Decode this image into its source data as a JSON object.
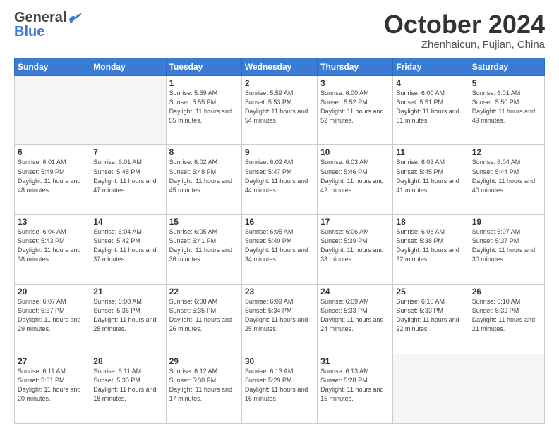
{
  "header": {
    "logo_general": "General",
    "logo_blue": "Blue",
    "title": "October 2024",
    "location": "Zhenhaicun, Fujian, China"
  },
  "weekdays": [
    "Sunday",
    "Monday",
    "Tuesday",
    "Wednesday",
    "Thursday",
    "Friday",
    "Saturday"
  ],
  "weeks": [
    [
      {
        "day": "",
        "empty": true
      },
      {
        "day": "",
        "empty": true
      },
      {
        "day": "1",
        "sunrise": "Sunrise: 5:59 AM",
        "sunset": "Sunset: 5:55 PM",
        "daylight": "Daylight: 11 hours and 55 minutes."
      },
      {
        "day": "2",
        "sunrise": "Sunrise: 5:59 AM",
        "sunset": "Sunset: 5:53 PM",
        "daylight": "Daylight: 11 hours and 54 minutes."
      },
      {
        "day": "3",
        "sunrise": "Sunrise: 6:00 AM",
        "sunset": "Sunset: 5:52 PM",
        "daylight": "Daylight: 11 hours and 52 minutes."
      },
      {
        "day": "4",
        "sunrise": "Sunrise: 6:00 AM",
        "sunset": "Sunset: 5:51 PM",
        "daylight": "Daylight: 11 hours and 51 minutes."
      },
      {
        "day": "5",
        "sunrise": "Sunrise: 6:01 AM",
        "sunset": "Sunset: 5:50 PM",
        "daylight": "Daylight: 11 hours and 49 minutes."
      }
    ],
    [
      {
        "day": "6",
        "sunrise": "Sunrise: 6:01 AM",
        "sunset": "Sunset: 5:49 PM",
        "daylight": "Daylight: 11 hours and 48 minutes."
      },
      {
        "day": "7",
        "sunrise": "Sunrise: 6:01 AM",
        "sunset": "Sunset: 5:48 PM",
        "daylight": "Daylight: 11 hours and 47 minutes."
      },
      {
        "day": "8",
        "sunrise": "Sunrise: 6:02 AM",
        "sunset": "Sunset: 5:48 PM",
        "daylight": "Daylight: 11 hours and 45 minutes."
      },
      {
        "day": "9",
        "sunrise": "Sunrise: 6:02 AM",
        "sunset": "Sunset: 5:47 PM",
        "daylight": "Daylight: 11 hours and 44 minutes."
      },
      {
        "day": "10",
        "sunrise": "Sunrise: 6:03 AM",
        "sunset": "Sunset: 5:46 PM",
        "daylight": "Daylight: 11 hours and 42 minutes."
      },
      {
        "day": "11",
        "sunrise": "Sunrise: 6:03 AM",
        "sunset": "Sunset: 5:45 PM",
        "daylight": "Daylight: 11 hours and 41 minutes."
      },
      {
        "day": "12",
        "sunrise": "Sunrise: 6:04 AM",
        "sunset": "Sunset: 5:44 PM",
        "daylight": "Daylight: 11 hours and 40 minutes."
      }
    ],
    [
      {
        "day": "13",
        "sunrise": "Sunrise: 6:04 AM",
        "sunset": "Sunset: 5:43 PM",
        "daylight": "Daylight: 11 hours and 38 minutes."
      },
      {
        "day": "14",
        "sunrise": "Sunrise: 6:04 AM",
        "sunset": "Sunset: 5:42 PM",
        "daylight": "Daylight: 11 hours and 37 minutes."
      },
      {
        "day": "15",
        "sunrise": "Sunrise: 6:05 AM",
        "sunset": "Sunset: 5:41 PM",
        "daylight": "Daylight: 11 hours and 36 minutes."
      },
      {
        "day": "16",
        "sunrise": "Sunrise: 6:05 AM",
        "sunset": "Sunset: 5:40 PM",
        "daylight": "Daylight: 11 hours and 34 minutes."
      },
      {
        "day": "17",
        "sunrise": "Sunrise: 6:06 AM",
        "sunset": "Sunset: 5:39 PM",
        "daylight": "Daylight: 11 hours and 33 minutes."
      },
      {
        "day": "18",
        "sunrise": "Sunrise: 6:06 AM",
        "sunset": "Sunset: 5:38 PM",
        "daylight": "Daylight: 11 hours and 32 minutes."
      },
      {
        "day": "19",
        "sunrise": "Sunrise: 6:07 AM",
        "sunset": "Sunset: 5:37 PM",
        "daylight": "Daylight: 11 hours and 30 minutes."
      }
    ],
    [
      {
        "day": "20",
        "sunrise": "Sunrise: 6:07 AM",
        "sunset": "Sunset: 5:37 PM",
        "daylight": "Daylight: 11 hours and 29 minutes."
      },
      {
        "day": "21",
        "sunrise": "Sunrise: 6:08 AM",
        "sunset": "Sunset: 5:36 PM",
        "daylight": "Daylight: 11 hours and 28 minutes."
      },
      {
        "day": "22",
        "sunrise": "Sunrise: 6:08 AM",
        "sunset": "Sunset: 5:35 PM",
        "daylight": "Daylight: 11 hours and 26 minutes."
      },
      {
        "day": "23",
        "sunrise": "Sunrise: 6:09 AM",
        "sunset": "Sunset: 5:34 PM",
        "daylight": "Daylight: 11 hours and 25 minutes."
      },
      {
        "day": "24",
        "sunrise": "Sunrise: 6:09 AM",
        "sunset": "Sunset: 5:33 PM",
        "daylight": "Daylight: 11 hours and 24 minutes."
      },
      {
        "day": "25",
        "sunrise": "Sunrise: 6:10 AM",
        "sunset": "Sunset: 5:33 PM",
        "daylight": "Daylight: 11 hours and 22 minutes."
      },
      {
        "day": "26",
        "sunrise": "Sunrise: 6:10 AM",
        "sunset": "Sunset: 5:32 PM",
        "daylight": "Daylight: 11 hours and 21 minutes."
      }
    ],
    [
      {
        "day": "27",
        "sunrise": "Sunrise: 6:11 AM",
        "sunset": "Sunset: 5:31 PM",
        "daylight": "Daylight: 11 hours and 20 minutes."
      },
      {
        "day": "28",
        "sunrise": "Sunrise: 6:11 AM",
        "sunset": "Sunset: 5:30 PM",
        "daylight": "Daylight: 11 hours and 18 minutes."
      },
      {
        "day": "29",
        "sunrise": "Sunrise: 6:12 AM",
        "sunset": "Sunset: 5:30 PM",
        "daylight": "Daylight: 11 hours and 17 minutes."
      },
      {
        "day": "30",
        "sunrise": "Sunrise: 6:13 AM",
        "sunset": "Sunset: 5:29 PM",
        "daylight": "Daylight: 11 hours and 16 minutes."
      },
      {
        "day": "31",
        "sunrise": "Sunrise: 6:13 AM",
        "sunset": "Sunset: 5:28 PM",
        "daylight": "Daylight: 11 hours and 15 minutes."
      },
      {
        "day": "",
        "empty": true
      },
      {
        "day": "",
        "empty": true
      }
    ]
  ]
}
